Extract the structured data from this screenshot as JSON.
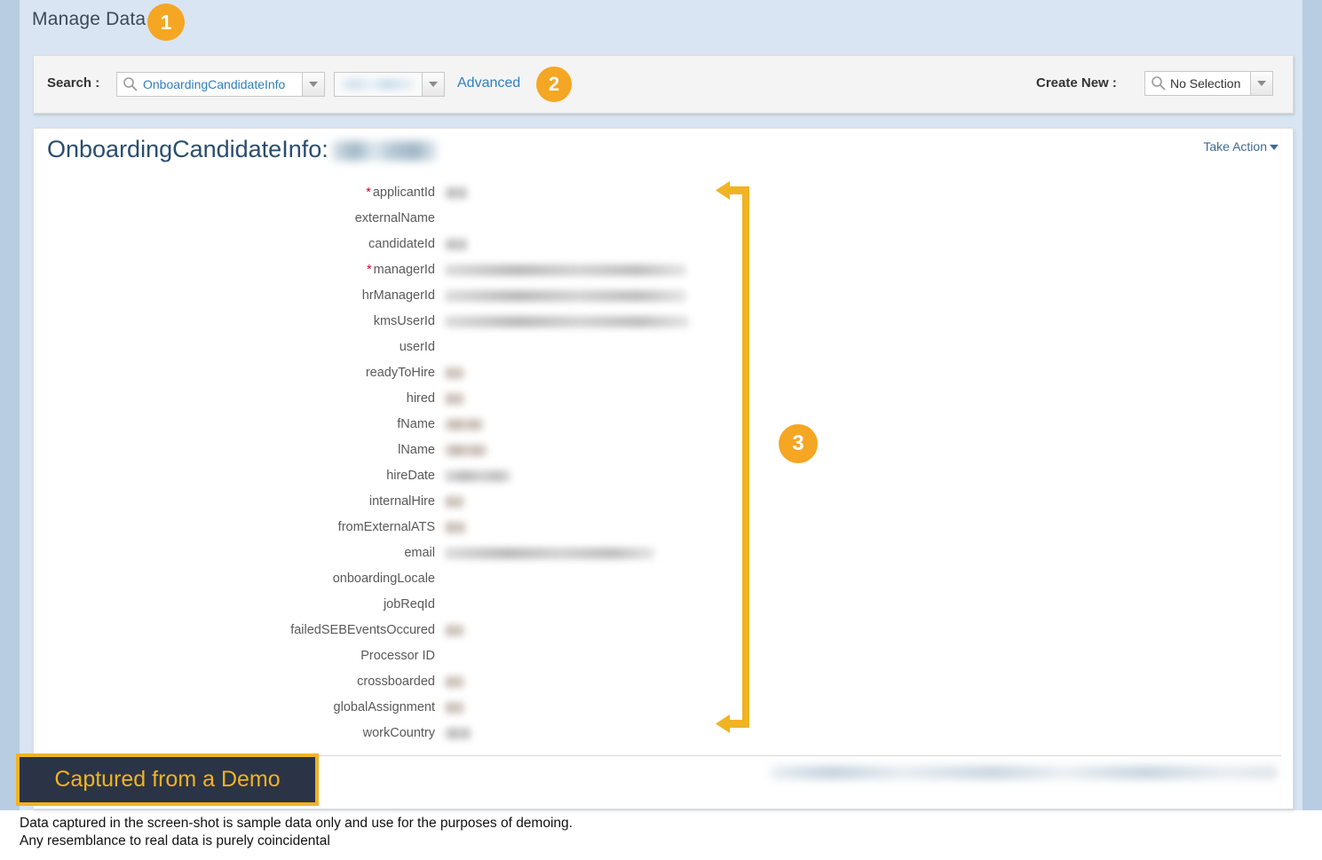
{
  "page": {
    "title": "Manage Data",
    "background_color": "#d9e5f2",
    "edge_color": "#b9cde2"
  },
  "markers": [
    {
      "id": "1",
      "label": "1"
    },
    {
      "id": "2",
      "label": "2"
    },
    {
      "id": "3",
      "label": "3"
    }
  ],
  "search_panel": {
    "search_label": "Search :",
    "search_value": "OnboardingCandidateInfo",
    "search_icon": "search-icon",
    "type_value": "",
    "advanced_link": "Advanced",
    "create_label": "Create New :",
    "create_value": "No Selection",
    "create_icon": "search-icon",
    "dropdown_icon": "chevron-down-icon"
  },
  "record": {
    "entity_label": "OnboardingCandidateInfo:",
    "record_name": "",
    "take_action": "Take Action",
    "take_action_icon": "chevron-down-icon",
    "updated_by": "",
    "fields": [
      {
        "label": "applicantId",
        "required": true,
        "value_width": 26,
        "value_tone": "gray"
      },
      {
        "label": "externalName",
        "required": false,
        "value_width": 0,
        "value_tone": "gray"
      },
      {
        "label": "candidateId",
        "required": false,
        "value_width": 26,
        "value_tone": "gray"
      },
      {
        "label": "managerId",
        "required": true,
        "value_width": 272,
        "value_tone": "gray"
      },
      {
        "label": "hrManagerId",
        "required": false,
        "value_width": 272,
        "value_tone": "gray"
      },
      {
        "label": "kmsUserId",
        "required": false,
        "value_width": 275,
        "value_tone": "gray"
      },
      {
        "label": "userId",
        "required": false,
        "value_width": 0,
        "value_tone": "gray"
      },
      {
        "label": "readyToHire",
        "required": false,
        "value_width": 22,
        "value_tone": "warm"
      },
      {
        "label": "hired",
        "required": false,
        "value_width": 22,
        "value_tone": "warm"
      },
      {
        "label": "fName",
        "required": false,
        "value_width": 44,
        "value_tone": "warm"
      },
      {
        "label": "lName",
        "required": false,
        "value_width": 48,
        "value_tone": "warm"
      },
      {
        "label": "hireDate",
        "required": false,
        "value_width": 75,
        "value_tone": "gray"
      },
      {
        "label": "internalHire",
        "required": false,
        "value_width": 22,
        "value_tone": "warm"
      },
      {
        "label": "fromExternalATS",
        "required": false,
        "value_width": 24,
        "value_tone": "warm"
      },
      {
        "label": "email",
        "required": false,
        "value_width": 236,
        "value_tone": "gray"
      },
      {
        "label": "onboardingLocale",
        "required": false,
        "value_width": 0,
        "value_tone": "gray"
      },
      {
        "label": "jobReqId",
        "required": false,
        "value_width": 0,
        "value_tone": "gray"
      },
      {
        "label": "failedSEBEventsOccured",
        "required": false,
        "value_width": 22,
        "value_tone": "warm"
      },
      {
        "label": "Processor ID",
        "required": false,
        "value_width": 0,
        "value_tone": "gray"
      },
      {
        "label": "crossboarded",
        "required": false,
        "value_width": 22,
        "value_tone": "warm"
      },
      {
        "label": "globalAssignment",
        "required": false,
        "value_width": 22,
        "value_tone": "warm"
      },
      {
        "label": "workCountry",
        "required": false,
        "value_width": 30,
        "value_tone": "gray"
      }
    ]
  },
  "demo_badge": {
    "text": "Captured from a Demo",
    "background_color": "#2b3446",
    "border_color": "#f0b323",
    "text_color": "#f0b323"
  },
  "disclaimer": {
    "line1": "Data captured in the screen-shot is sample data only and use for the purposes of demoing.",
    "line2": "Any resemblance to real data is purely coincidental"
  },
  "annotation": {
    "arrow_color": "#f0b323",
    "arrow_name": "vertical-double-arrow"
  }
}
